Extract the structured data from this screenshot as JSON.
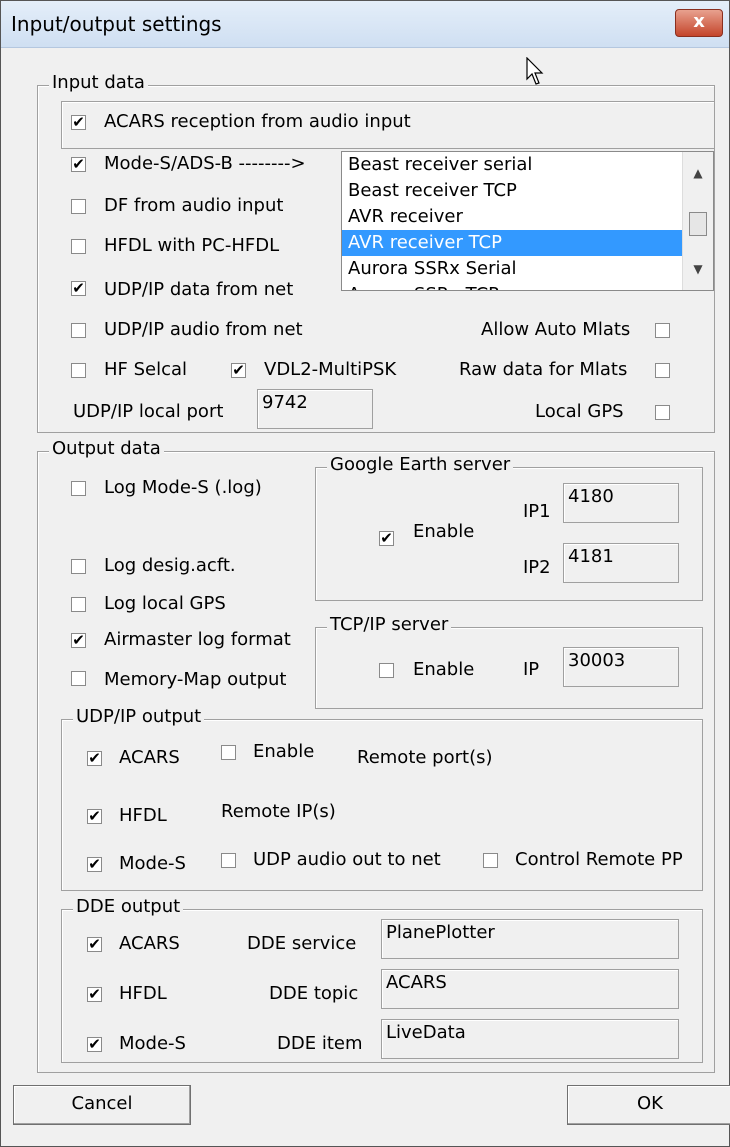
{
  "window": {
    "title": "Input/output settings",
    "close_label": "x"
  },
  "input_data": {
    "group_label": "Input data",
    "acars_audio": {
      "label": "ACARS reception from audio input",
      "checked": true
    },
    "mode_s": {
      "label": "Mode-S/ADS-B -------->",
      "checked": true
    },
    "df_audio": {
      "label": "DF from audio input",
      "checked": false
    },
    "hfdl": {
      "label": "HFDL with PC-HFDL",
      "checked": false
    },
    "udp_data": {
      "label": "UDP/IP data from net",
      "checked": true
    },
    "udp_audio": {
      "label": "UDP/IP audio from net",
      "checked": false
    },
    "hf_selcal": {
      "label": "HF Selcal",
      "checked": false
    },
    "vdl2": {
      "label": "VDL2-MultiPSK",
      "checked": true
    },
    "allow_mlats": {
      "label": "Allow Auto Mlats",
      "checked": false
    },
    "raw_mlats": {
      "label": "Raw data for Mlats",
      "checked": false
    },
    "local_gps": {
      "label": "Local GPS",
      "checked": false
    },
    "udp_port_label": "UDP/IP local port",
    "udp_port_value": "9742",
    "receiver_list": [
      "Beast receiver serial",
      "Beast receiver TCP",
      "AVR receiver",
      "AVR receiver TCP",
      "Aurora SSRx Serial",
      "Aurora SSRx TCP"
    ],
    "receiver_selected": "AVR receiver TCP"
  },
  "output_data": {
    "group_label": "Output data",
    "log_mode_s": {
      "label": "Log Mode-S (.log)",
      "checked": false
    },
    "log_desig": {
      "label": "Log desig.acft.",
      "checked": false
    },
    "log_gps": {
      "label": "Log local GPS",
      "checked": false
    },
    "airmaster": {
      "label": "Airmaster log format",
      "checked": true
    },
    "memory_map": {
      "label": "Memory-Map output",
      "checked": false
    },
    "google_earth": {
      "group_label": "Google Earth server",
      "enable_label": "Enable",
      "enabled": true,
      "ip1_label": "IP1",
      "ip1_value": "4180",
      "ip2_label": "IP2",
      "ip2_value": "4181"
    },
    "tcp_server": {
      "group_label": "TCP/IP server",
      "enable_label": "Enable",
      "enabled": false,
      "ip_label": "IP",
      "ip_value": "30003"
    },
    "udp_output": {
      "group_label": "UDP/IP output",
      "acars": {
        "label": "ACARS",
        "checked": true
      },
      "enable": {
        "label": "Enable",
        "checked": false
      },
      "remote_ports_label": "Remote port(s)",
      "hfdl": {
        "label": "HFDL",
        "checked": true
      },
      "remote_ips_label": "Remote IP(s)",
      "mode_s": {
        "label": "Mode-S",
        "checked": true
      },
      "udp_audio_out": {
        "label": "UDP audio out to net",
        "checked": false
      },
      "control_remote": {
        "label": "Control Remote PP",
        "checked": false
      }
    },
    "dde_output": {
      "group_label": "DDE output",
      "acars": {
        "label": "ACARS",
        "checked": true
      },
      "hfdl": {
        "label": "HFDL",
        "checked": true
      },
      "mode_s": {
        "label": "Mode-S",
        "checked": true
      },
      "service_label": "DDE service",
      "service_value": "PlanePlotter",
      "topic_label": "DDE topic",
      "topic_value": "ACARS",
      "item_label": "DDE item",
      "item_value": "LiveData"
    }
  },
  "buttons": {
    "cancel": "Cancel",
    "ok": "OK"
  }
}
